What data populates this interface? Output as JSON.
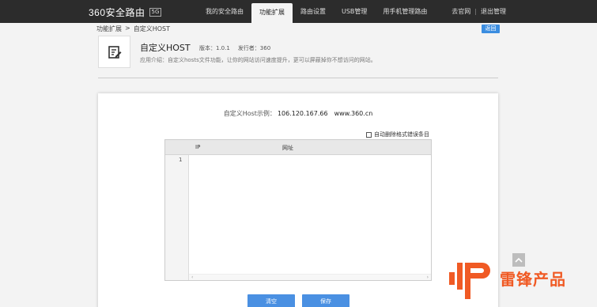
{
  "header": {
    "logo_text": "360安全路由",
    "logo_badge": "5G",
    "nav": [
      {
        "label": "我的安全路由",
        "active": false
      },
      {
        "label": "功能扩展",
        "active": true
      },
      {
        "label": "路由设置",
        "active": false
      },
      {
        "label": "USB管理",
        "active": false
      },
      {
        "label": "用手机管理路由",
        "active": false
      }
    ],
    "right_links": {
      "official": "去官网",
      "separator": "|",
      "logout": "退出管理"
    }
  },
  "breadcrumb": {
    "parent": "功能扩展",
    "arrow": ">",
    "current": "自定义HOST"
  },
  "back_label": "返回",
  "app": {
    "title": "自定义HOST",
    "version": "版本：1.0.1",
    "publisher": "发行者：360",
    "description": "应用介绍：自定义hosts文件功能，让你的网站访问速度提升，更可以屏蔽掉你不想访问的网站。",
    "icon": "edit-icon"
  },
  "panel": {
    "example_label": "自定义Host示例：",
    "example_ip": "106.120.167.66",
    "example_domain": "www.360.cn",
    "auto_delete_label": "自动删除格式错误条目",
    "auto_delete_checked": false,
    "columns": [
      "IP",
      "网址"
    ],
    "line_number": "1",
    "scroll_left": "‹",
    "scroll_right": "›",
    "clear_label": "清空",
    "save_label": "保存"
  },
  "watermark": {
    "text": "雷锋产品"
  },
  "colors": {
    "topbar": "#2c2c2c",
    "accent_blue": "#4a90e2",
    "watermark": "#f05a24"
  }
}
